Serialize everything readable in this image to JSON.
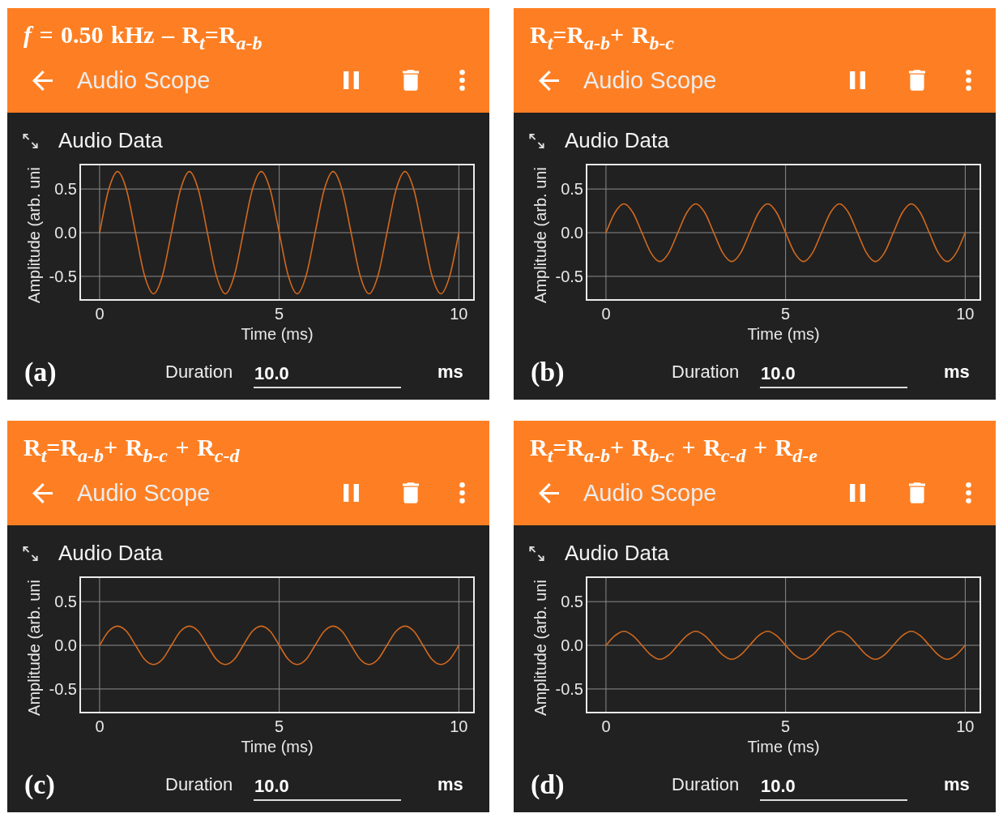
{
  "panels": [
    {
      "caption": "*f* = 0.50 kHz – R$_{t}$=R$_{a-b}$",
      "toolbar": {
        "title": "Audio Scope"
      },
      "section": {
        "title": "Audio Data"
      },
      "chart_data": {
        "type": "line",
        "xlabel": "Time (ms)",
        "ylabel": "Amplitude (arb. uni",
        "grid": true,
        "xlim": [
          -0.54,
          10.42
        ],
        "ylim": [
          -0.77,
          0.78
        ],
        "xticks": [
          0,
          5,
          10
        ],
        "yticks": [
          {
            "value": 0.5,
            "label": "0.5"
          },
          {
            "value": 0,
            "label": "0.0"
          },
          {
            "value": -0.5,
            "label": "-0.5"
          }
        ],
        "x": [
          0,
          0.25,
          0.5,
          0.75,
          1,
          1.25,
          1.5,
          1.75,
          2,
          2.25,
          2.5,
          2.75,
          3,
          3.25,
          3.5,
          3.75,
          4,
          4.25,
          4.5,
          4.75,
          5,
          5.25,
          5.5,
          5.75,
          6,
          6.25,
          6.5,
          6.75,
          7,
          7.25,
          7.5,
          7.75,
          8,
          8.25,
          8.5,
          8.75,
          9,
          9.25,
          9.5,
          9.75,
          10
        ],
        "values": [
          0,
          0.49,
          0.7,
          0.49,
          0,
          -0.49,
          -0.7,
          -0.49,
          0,
          0.49,
          0.7,
          0.49,
          0,
          -0.49,
          -0.7,
          -0.49,
          0,
          0.49,
          0.7,
          0.49,
          0,
          -0.49,
          -0.7,
          -0.49,
          0,
          0.49,
          0.7,
          0.49,
          0,
          -0.49,
          -0.7,
          -0.49,
          0,
          0.49,
          0.7,
          0.49,
          0,
          -0.49,
          -0.7,
          -0.49,
          0
        ]
      },
      "footer": {
        "label": "(a)",
        "duration_label": "Duration",
        "duration_value": "10.0",
        "unit": "ms"
      }
    },
    {
      "caption": "R$_{t}$=R$_{a-b}$+ R$_{b-c}$",
      "toolbar": {
        "title": "Audio Scope"
      },
      "section": {
        "title": "Audio Data"
      },
      "chart_data": {
        "type": "line",
        "xlabel": "Time (ms)",
        "ylabel": "Amplitude (arb. uni",
        "grid": true,
        "xlim": [
          -0.54,
          10.42
        ],
        "ylim": [
          -0.77,
          0.78
        ],
        "xticks": [
          0,
          5,
          10
        ],
        "yticks": [
          {
            "value": 0.5,
            "label": "0.5"
          },
          {
            "value": 0,
            "label": "0.0"
          },
          {
            "value": -0.5,
            "label": "-0.5"
          }
        ],
        "x": [
          0,
          0.25,
          0.5,
          0.75,
          1,
          1.25,
          1.5,
          1.75,
          2,
          2.25,
          2.5,
          2.75,
          3,
          3.25,
          3.5,
          3.75,
          4,
          4.25,
          4.5,
          4.75,
          5,
          5.25,
          5.5,
          5.75,
          6,
          6.25,
          6.5,
          6.75,
          7,
          7.25,
          7.5,
          7.75,
          8,
          8.25,
          8.5,
          8.75,
          9,
          9.25,
          9.5,
          9.75,
          10
        ],
        "values": [
          0,
          0.23,
          0.33,
          0.23,
          0,
          -0.23,
          -0.33,
          -0.23,
          0,
          0.23,
          0.33,
          0.23,
          0,
          -0.23,
          -0.33,
          -0.23,
          0,
          0.23,
          0.33,
          0.23,
          0,
          -0.23,
          -0.33,
          -0.23,
          0,
          0.23,
          0.33,
          0.23,
          0,
          -0.23,
          -0.33,
          -0.23,
          0,
          0.23,
          0.33,
          0.23,
          0,
          -0.23,
          -0.33,
          -0.23,
          0
        ]
      },
      "footer": {
        "label": "(b)",
        "duration_label": "Duration",
        "duration_value": "10.0",
        "unit": "ms"
      }
    },
    {
      "caption": "R$_{t}$=R$_{a-b}$+ R$_{b-c}$ + R$_{c-d}$",
      "toolbar": {
        "title": "Audio Scope"
      },
      "section": {
        "title": "Audio Data"
      },
      "chart_data": {
        "type": "line",
        "xlabel": "Time (ms)",
        "ylabel": "Amplitude (arb. uni",
        "grid": true,
        "xlim": [
          -0.54,
          10.42
        ],
        "ylim": [
          -0.77,
          0.78
        ],
        "xticks": [
          0,
          5,
          10
        ],
        "yticks": [
          {
            "value": 0.5,
            "label": "0.5"
          },
          {
            "value": 0,
            "label": "0.0"
          },
          {
            "value": -0.5,
            "label": "-0.5"
          }
        ],
        "x": [
          0,
          0.25,
          0.5,
          0.75,
          1,
          1.25,
          1.5,
          1.75,
          2,
          2.25,
          2.5,
          2.75,
          3,
          3.25,
          3.5,
          3.75,
          4,
          4.25,
          4.5,
          4.75,
          5,
          5.25,
          5.5,
          5.75,
          6,
          6.25,
          6.5,
          6.75,
          7,
          7.25,
          7.5,
          7.75,
          8,
          8.25,
          8.5,
          8.75,
          9,
          9.25,
          9.5,
          9.75,
          10
        ],
        "values": [
          0,
          0.16,
          0.22,
          0.16,
          0,
          -0.16,
          -0.22,
          -0.16,
          0,
          0.16,
          0.22,
          0.16,
          0,
          -0.16,
          -0.22,
          -0.16,
          0,
          0.16,
          0.22,
          0.16,
          0,
          -0.16,
          -0.22,
          -0.16,
          0,
          0.16,
          0.22,
          0.16,
          0,
          -0.16,
          -0.22,
          -0.16,
          0,
          0.16,
          0.22,
          0.16,
          0,
          -0.16,
          -0.22,
          -0.16,
          0
        ]
      },
      "footer": {
        "label": "(c)",
        "duration_label": "Duration",
        "duration_value": "10.0",
        "unit": "ms"
      }
    },
    {
      "caption": "R$_{t}$=R$_{a-b}$+ R$_{b-c}$ + R$_{c-d}$ + R$_{d-e}$",
      "toolbar": {
        "title": "Audio Scope"
      },
      "section": {
        "title": "Audio Data"
      },
      "chart_data": {
        "type": "line",
        "xlabel": "Time (ms)",
        "ylabel": "Amplitude (arb. uni",
        "grid": true,
        "xlim": [
          -0.54,
          10.42
        ],
        "ylim": [
          -0.77,
          0.78
        ],
        "xticks": [
          0,
          5,
          10
        ],
        "yticks": [
          {
            "value": 0.5,
            "label": "0.5"
          },
          {
            "value": 0,
            "label": "0.0"
          },
          {
            "value": -0.5,
            "label": "-0.5"
          }
        ],
        "x": [
          0,
          0.25,
          0.5,
          0.75,
          1,
          1.25,
          1.5,
          1.75,
          2,
          2.25,
          2.5,
          2.75,
          3,
          3.25,
          3.5,
          3.75,
          4,
          4.25,
          4.5,
          4.75,
          5,
          5.25,
          5.5,
          5.75,
          6,
          6.25,
          6.5,
          6.75,
          7,
          7.25,
          7.5,
          7.75,
          8,
          8.25,
          8.5,
          8.75,
          9,
          9.25,
          9.5,
          9.75,
          10
        ],
        "values": [
          0,
          0.11,
          0.16,
          0.11,
          0,
          -0.11,
          -0.16,
          -0.11,
          0,
          0.11,
          0.16,
          0.11,
          0,
          -0.11,
          -0.16,
          -0.11,
          0,
          0.11,
          0.16,
          0.11,
          0,
          -0.11,
          -0.16,
          -0.11,
          0,
          0.11,
          0.16,
          0.11,
          0,
          -0.11,
          -0.16,
          -0.11,
          0,
          0.11,
          0.16,
          0.11,
          0,
          -0.11,
          -0.16,
          -0.11,
          0
        ]
      },
      "footer": {
        "label": "(d)",
        "duration_label": "Duration",
        "duration_value": "10.0",
        "unit": "ms"
      }
    }
  ]
}
